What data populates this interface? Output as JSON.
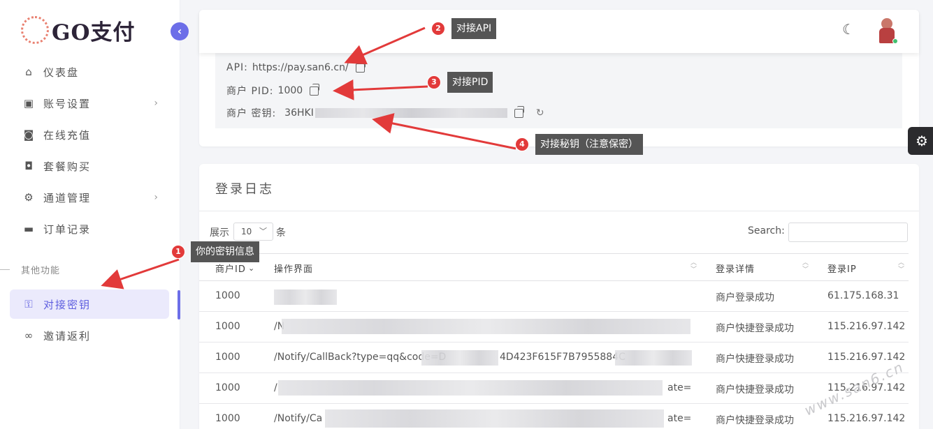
{
  "brand": {
    "logo_text": "GO支付"
  },
  "sidebar": {
    "items": [
      {
        "label": "仪表盘",
        "icon": "home-icon"
      },
      {
        "label": "账号设置",
        "icon": "account-icon"
      },
      {
        "label": "在线充值",
        "icon": "camera-icon"
      },
      {
        "label": "套餐购买",
        "icon": "bag-icon"
      },
      {
        "label": "通道管理",
        "icon": "gear-icon"
      },
      {
        "label": "订单记录",
        "icon": "wallet-icon"
      }
    ],
    "section_label": "其他功能",
    "sub_items": [
      {
        "label": "对接密钥",
        "icon": "key-icon"
      },
      {
        "label": "邀请返利",
        "icon": "link-icon"
      }
    ]
  },
  "api_info": {
    "api_label": "API:",
    "api_value": "https://pay.san6.cn/",
    "pid_label": "商户 PID:",
    "pid_value": "1000",
    "key_label": "商户 密钥:",
    "key_value": "36HKI"
  },
  "log": {
    "title": "登录日志",
    "show_label": "展示",
    "entries_value": "10",
    "entries_unit": "条",
    "search_label": "Search:",
    "columns": [
      "商户ID",
      "操作界面",
      "登录详情",
      "登录IP"
    ],
    "rows": [
      {
        "id": "1000",
        "page": "",
        "detail": "商户登录成功",
        "ip": "61.175.168.31"
      },
      {
        "id": "1000",
        "page": "/N",
        "detail": "商户快捷登录成功",
        "ip": "115.216.97.142"
      },
      {
        "id": "1000",
        "page": "/Notify/CallBack?type=qq&code=D",
        "page_tail": "4D423F615F7B7955884C",
        "detail": "商户快捷登录成功",
        "ip": "115.216.97.142"
      },
      {
        "id": "1000",
        "page": "/",
        "page_tail": "ate=",
        "detail": "商户快捷登录成功",
        "ip": "115.216.97.142"
      },
      {
        "id": "1000",
        "page": "/Notify/Ca",
        "page_tail": "ate=",
        "detail": "商户快捷登录成功",
        "ip": "115.216.97.142"
      }
    ]
  },
  "annotations": {
    "c1": "你的密钥信息",
    "c2": "对接API",
    "c3": "对接PID",
    "c4": "对接秘钥（注意保密）",
    "n1": "1",
    "n2": "2",
    "n3": "3",
    "n4": "4"
  },
  "watermark": "www.san6.cn",
  "colors": {
    "accent": "#6c6ee8",
    "annotation_red": "#e23a3a",
    "callout_bg": "#555555"
  }
}
